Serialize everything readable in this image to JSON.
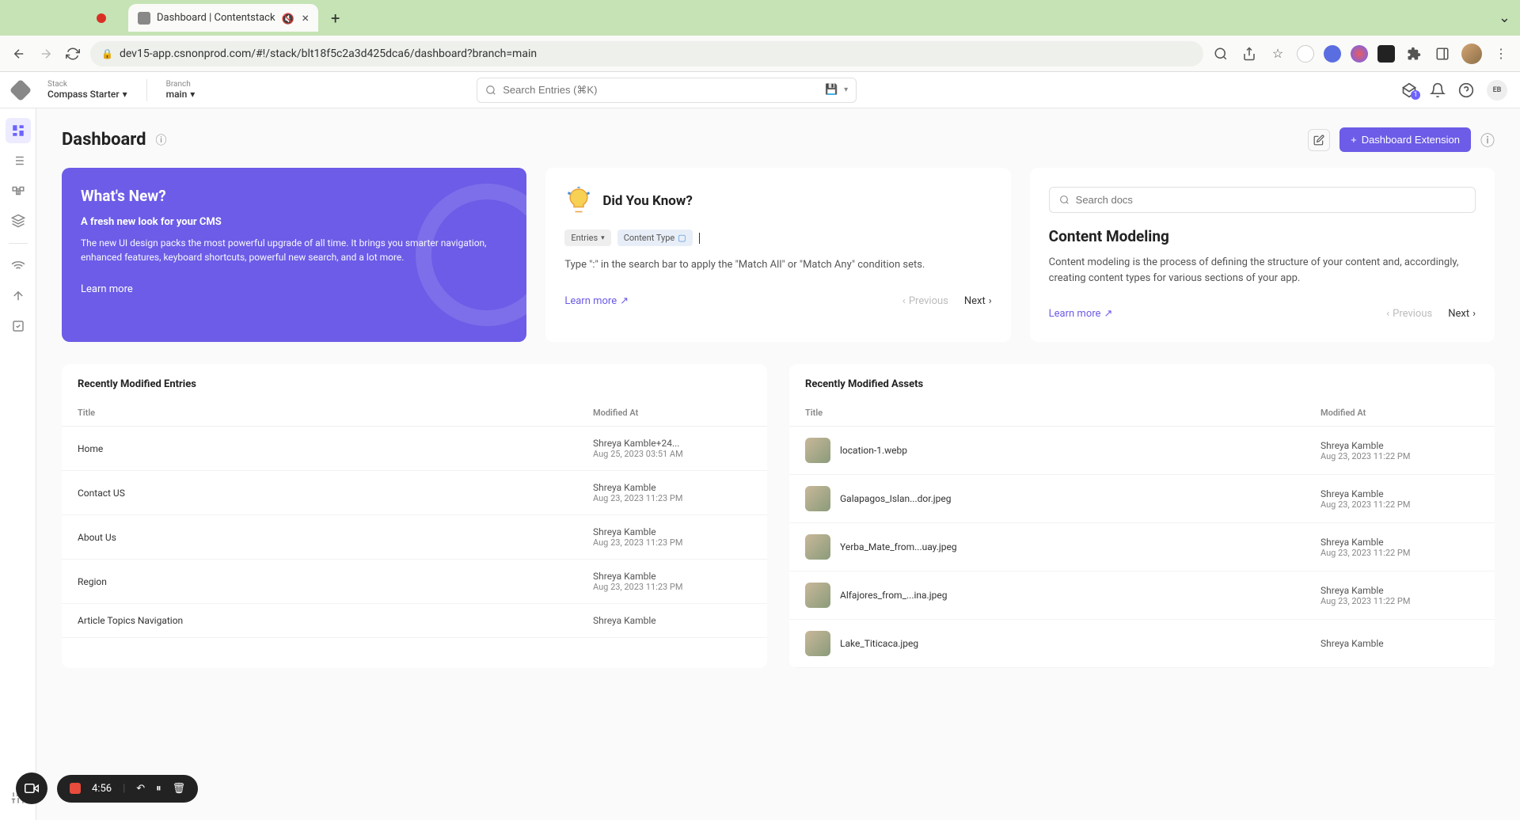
{
  "browser": {
    "tab_title": "Dashboard | Contentstack",
    "url": "dev15-app.csnonprod.com/#!/stack/blt18f5c2a3d425dca6/dashboard?branch=main"
  },
  "header": {
    "stack_label": "Stack",
    "stack_value": "Compass Starter",
    "branch_label": "Branch",
    "branch_value": "main",
    "search_placeholder": "Search Entries (⌘K)",
    "inbox_badge": "1",
    "user_initials": "EB"
  },
  "page": {
    "title": "Dashboard",
    "extension_btn": "Dashboard Extension"
  },
  "whats_new": {
    "heading": "What's New?",
    "subhead": "A fresh new look for your CMS",
    "body": "The new UI design packs the most powerful upgrade of all time. It brings you smarter navigation, enhanced features, keyboard shortcuts, powerful new search, and a lot more.",
    "learn": "Learn more"
  },
  "dyk": {
    "heading": "Did You Know?",
    "chip1": "Entries",
    "chip2": "Content Type",
    "body": "Type \":\" in the search bar to apply the \"Match All\" or \"Match Any\" condition sets.",
    "learn": "Learn more",
    "prev": "Previous",
    "next": "Next"
  },
  "docs": {
    "search_placeholder": "Search docs",
    "heading": "Content Modeling",
    "body": "Content modeling is the process of defining the structure of your content and, accordingly, creating content types for various sections of your app.",
    "learn": "Learn more",
    "prev": "Previous",
    "next": "Next"
  },
  "entries": {
    "title": "Recently Modified Entries",
    "col_title": "Title",
    "col_mod": "Modified At",
    "rows": [
      {
        "title": "Home",
        "who": "Shreya Kamble+24...",
        "when": "Aug 25, 2023 03:51 AM"
      },
      {
        "title": "Contact US",
        "who": "Shreya Kamble",
        "when": "Aug 23, 2023 11:23 PM"
      },
      {
        "title": "About Us",
        "who": "Shreya Kamble",
        "when": "Aug 23, 2023 11:23 PM"
      },
      {
        "title": "Region",
        "who": "Shreya Kamble",
        "when": "Aug 23, 2023 11:23 PM"
      },
      {
        "title": "Article Topics Navigation",
        "who": "Shreya Kamble",
        "when": ""
      }
    ]
  },
  "assets": {
    "title": "Recently Modified Assets",
    "col_title": "Title",
    "col_mod": "Modified At",
    "rows": [
      {
        "title": "location-1.webp",
        "who": "Shreya Kamble",
        "when": "Aug 23, 2023 11:22 PM"
      },
      {
        "title": "Galapagos_Islan...dor.jpeg",
        "who": "Shreya Kamble",
        "when": "Aug 23, 2023 11:22 PM"
      },
      {
        "title": "Yerba_Mate_from...uay.jpeg",
        "who": "Shreya Kamble",
        "when": "Aug 23, 2023 11:22 PM"
      },
      {
        "title": "Alfajores_from_...ina.jpeg",
        "who": "Shreya Kamble",
        "when": "Aug 23, 2023 11:22 PM"
      },
      {
        "title": "Lake_Titicaca.jpeg",
        "who": "Shreya Kamble",
        "when": ""
      }
    ]
  },
  "recorder": {
    "time": "4:56"
  }
}
